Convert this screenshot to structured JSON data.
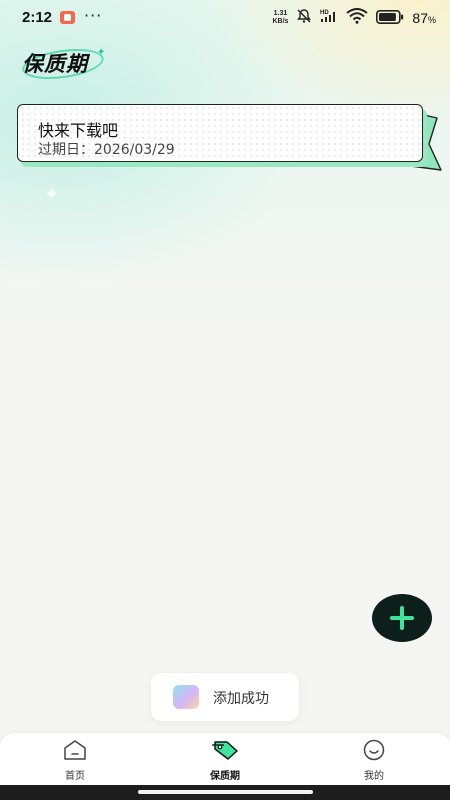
{
  "status_bar": {
    "time": "2:12",
    "more": "···",
    "net_speed_value": "1.31",
    "net_speed_unit": "KB/s",
    "battery_percent": "87",
    "battery_unit": "%",
    "battery_level": 0.87
  },
  "header": {
    "logo_text": "保质期"
  },
  "items": [
    {
      "name": "快来下载吧",
      "expiry_label": "过期日：",
      "expiry_date": "2026/03/29"
    }
  ],
  "fab": {
    "icon": "plus-icon"
  },
  "toast": {
    "message": "添加成功",
    "icon": "app-icon"
  },
  "bottom_nav": {
    "items": [
      {
        "label": "首页",
        "icon": "home-icon",
        "active": false
      },
      {
        "label": "保质期",
        "icon": "tag-icon",
        "active": true
      },
      {
        "label": "我的",
        "icon": "smile-icon",
        "active": false
      }
    ]
  },
  "colors": {
    "accent": "#3ad09a",
    "fab_bg": "#0c1f1b",
    "fab_plus": "#3ee39f",
    "card_shadow": "#9be7c2"
  }
}
